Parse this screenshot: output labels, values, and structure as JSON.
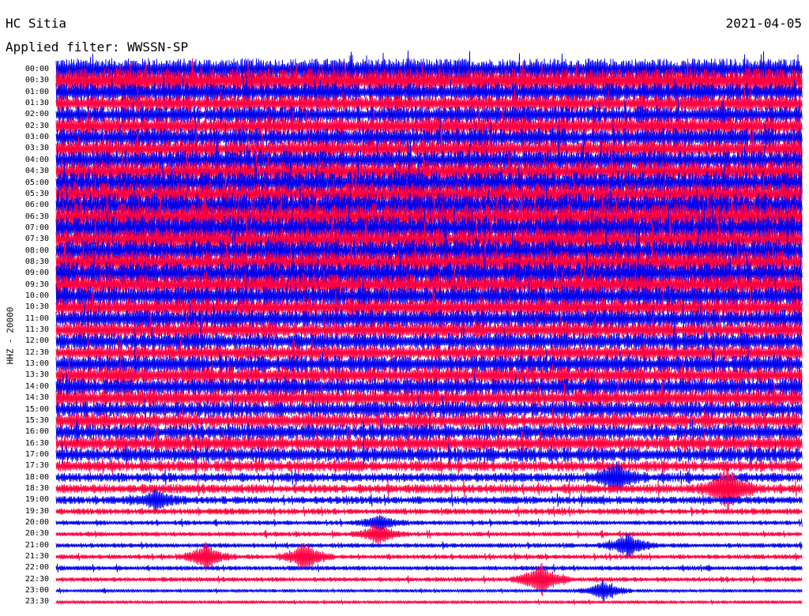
{
  "header": {
    "station": "HC Sitia",
    "date": "2021-04-05",
    "filter": "Applied filter: WWSSN-SP"
  },
  "chart_data": {
    "type": "line",
    "title": "HC Sitia",
    "date": "2021-04-05",
    "filter": "Applied filter: WWSSN-SP",
    "channel_label": "HHZ - 20000",
    "row_minutes": 30,
    "trace_colors": [
      "#0000ee",
      "#ff0040"
    ],
    "row_labels": [
      "00:00",
      "00:30",
      "01:00",
      "01:30",
      "02:00",
      "02:30",
      "03:00",
      "03:30",
      "04:00",
      "04:30",
      "05:00",
      "05:30",
      "06:00",
      "06:30",
      "07:00",
      "07:30",
      "08:00",
      "08:30",
      "09:00",
      "09:30",
      "10:00",
      "10:30",
      "11:00",
      "11:30",
      "12:00",
      "12:30",
      "13:00",
      "13:30",
      "14:00",
      "14:30",
      "15:00",
      "15:30",
      "16:00",
      "16:30",
      "17:00",
      "17:30",
      "18:00",
      "18:30",
      "19:00",
      "19:30",
      "20:00",
      "20:30",
      "21:00",
      "21:30",
      "22:00",
      "22:30",
      "23:00",
      "23:30"
    ],
    "noise_level": [
      14,
      16,
      12,
      11,
      11,
      12,
      12,
      12,
      13,
      14,
      15,
      15,
      16,
      17,
      16,
      15,
      15,
      15,
      15,
      14,
      13,
      12,
      12,
      11,
      11,
      10,
      11,
      11,
      11,
      11,
      10,
      10,
      10,
      10,
      9,
      7,
      6,
      6,
      5,
      4,
      3,
      3,
      3,
      3,
      3,
      3,
      2,
      2
    ],
    "events": [
      {
        "row": 36,
        "minute": 22.5,
        "amplitude": 18
      },
      {
        "row": 37,
        "minute": 27,
        "amplitude": 28
      },
      {
        "row": 38,
        "minute": 4,
        "amplitude": 12
      },
      {
        "row": 40,
        "minute": 13,
        "amplitude": 10
      },
      {
        "row": 41,
        "minute": 13,
        "amplitude": 14
      },
      {
        "row": 42,
        "minute": 23,
        "amplitude": 16
      },
      {
        "row": 43,
        "minute": 6,
        "amplitude": 18
      },
      {
        "row": 43,
        "minute": 10,
        "amplitude": 20
      },
      {
        "row": 45,
        "minute": 19.5,
        "amplitude": 25
      },
      {
        "row": 46,
        "minute": 22,
        "amplitude": 14
      }
    ]
  }
}
